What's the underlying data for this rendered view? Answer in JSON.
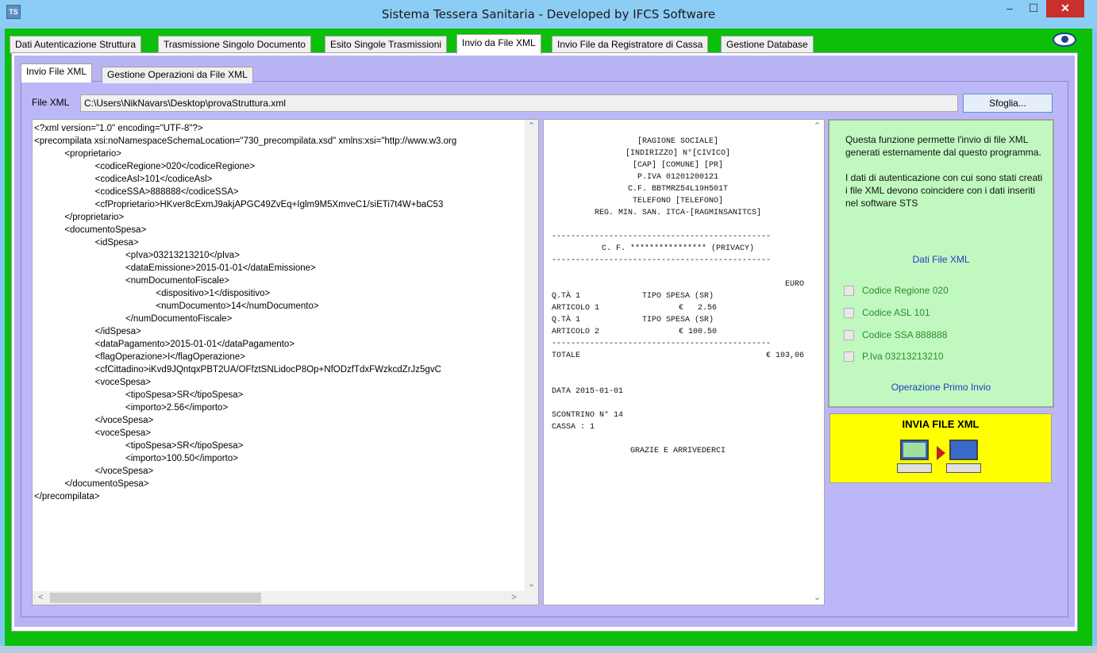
{
  "window": {
    "title": "Sistema Tessera Sanitaria - Developed by IFCS Software",
    "min_label": "–",
    "max_label": "☐",
    "close_label": "✕",
    "icon_text": "TS"
  },
  "main_tabs": [
    {
      "label": "Dati Autenticazione Struttura"
    },
    {
      "label": "Trasmissione Singolo Documento"
    },
    {
      "label": "Esito Singole Trasmissioni"
    },
    {
      "label": "Invio da File XML"
    },
    {
      "label": "Invio File da Registratore di Cassa"
    },
    {
      "label": "Gestione Database"
    }
  ],
  "sub_tabs": [
    {
      "label": "Invio File XML"
    },
    {
      "label": "Gestione Operazioni da File XML"
    }
  ],
  "file": {
    "label": "File XML",
    "value": "C:\\Users\\NikNavars\\Desktop\\provaStruttura.xml",
    "browse_label": "Sfoglia..."
  },
  "xml_lines": [
    "<?xml version=\"1.0\" encoding=\"UTF-8\"?>",
    "<precompilata xsi:noNamespaceSchemaLocation=\"730_precompilata.xsd\" xmlns:xsi=\"http://www.w3.org",
    "            <proprietario>",
    "                        <codiceRegione>020</codiceRegione>",
    "                        <codiceAsl>101</codiceAsl>",
    "                        <codiceSSA>888888</codiceSSA>",
    "                        <cfProprietario>HKver8cExmJ9akjAPGC49ZvEq+Iglm9M5XmveC1/siETi7t4W+baC53",
    "            </proprietario>",
    "            <documentoSpesa>",
    "                        <idSpesa>",
    "                                    <pIva>03213213210</pIva>",
    "                                    <dataEmissione>2015-01-01</dataEmissione>",
    "                                    <numDocumentoFiscale>",
    "                                                <dispositivo>1</dispositivo>",
    "                                                <numDocumento>14</numDocumento>",
    "                                    </numDocumentoFiscale>",
    "                        </idSpesa>",
    "                        <dataPagamento>2015-01-01</dataPagamento>",
    "                        <flagOperazione>I</flagOperazione>",
    "                        <cfCittadino>iKvd9JQntqxPBT2UA/OFfztSNLidocP8Op+NfODzfTdxFWzkcdZrJz5gvC",
    "                        <voceSpesa>",
    "                                    <tipoSpesa>SR</tipoSpesa>",
    "                                    <importo>2.56</importo>",
    "                        </voceSpesa>",
    "                        <voceSpesa>",
    "                                    <tipoSpesa>SR</tipoSpesa>",
    "                                    <importo>100.50</importo>",
    "                        </voceSpesa>",
    "            </documentoSpesa>",
    "</precompilata>"
  ],
  "receipt": {
    "header": [
      "[RAGIONE SOCIALE]",
      "[INDIRIZZO] N°[CIVICO]",
      "[CAP] [COMUNE] [PR]",
      "P.IVA 01201200121",
      "C.F. BBTMRZ54L19H501T",
      "TELEFONO [TELEFONO]",
      "REG. MIN. SAN. ITCA-[RAGMINSANITCS]"
    ],
    "rule": "----------------------------------------------",
    "cf_line": "C. F. **************** (PRIVACY)",
    "currency": "EURO",
    "items": [
      {
        "qty": "Q.TÀ 1",
        "type": "TIPO SPESA (SR)",
        "name": "ARTICOLO 1",
        "price": "€   2.56"
      },
      {
        "qty": "Q.TÀ 1",
        "type": "TIPO SPESA (SR)",
        "name": "ARTICOLO 2",
        "price": "€ 100.50"
      }
    ],
    "total_label": "TOTALE",
    "total_value": "€ 103,06",
    "date_line": "DATA 2015-01-01",
    "receipt_no": "SCONTRINO N° 14",
    "register": "CASSA : 1",
    "farewell": "GRAZIE E ARRIVEDERCI"
  },
  "info": {
    "paragraph1": "Questa funzione permette l'invio di file XML generati esternamente dal questo programma.",
    "paragraph2": "I dati di autenticazione con cui sono stati creati i file XML devono coincidere con i dati inseriti nel software STS",
    "section_title": "Dati File XML",
    "checks": [
      {
        "label": "Codice Regione 020"
      },
      {
        "label": "Codice ASL 101"
      },
      {
        "label": "Codice SSA 888888"
      },
      {
        "label": "P.Iva 03213213210"
      }
    ],
    "operation": "Operazione Primo Invio"
  },
  "send_button": {
    "label": "INVIA FILE XML"
  },
  "colors": {
    "frame_green": "#0bbf0b",
    "panel_lavender": "#bcb8f8",
    "info_green": "#c0f8c0",
    "send_yellow": "#ffff00",
    "link_blue": "#1f3fbf",
    "check_green": "#2e8c2e",
    "close_red": "#c7302b"
  }
}
